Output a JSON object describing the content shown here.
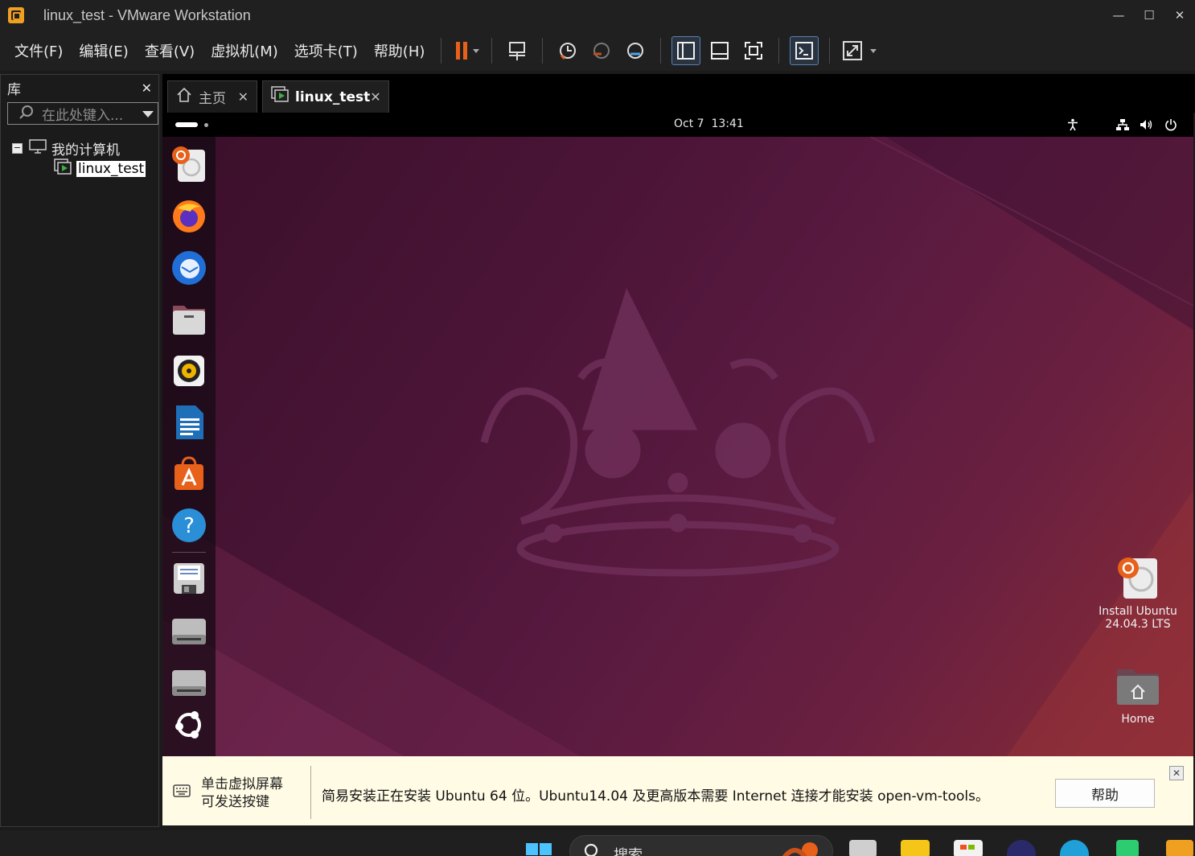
{
  "window": {
    "title": "linux_test - VMware Workstation"
  },
  "menu": {
    "items": [
      "文件(F)",
      "编辑(E)",
      "查看(V)",
      "虚拟机(M)",
      "选项卡(T)",
      "帮助(H)"
    ]
  },
  "library": {
    "title": "库",
    "search_placeholder": "在此处键入...",
    "tree_root": "我的计算机",
    "tree_child": "linux_test"
  },
  "tabs": [
    {
      "label": "主页"
    },
    {
      "label": "linux_test"
    }
  ],
  "guest": {
    "date": "Oct 7",
    "time": "13:41",
    "desktop_icons": [
      {
        "label_line1": "Install Ubuntu",
        "label_line2": "24.04.3 LTS"
      },
      {
        "label_line1": "Home"
      }
    ]
  },
  "hint": {
    "left_line1": "单击虚拟屏幕",
    "left_line2": "可发送按键",
    "message": "简易安装正在安装 Ubuntu 64 位。Ubuntu14.04 及更高版本需要 Internet 连接才能安装 open-vm-tools。",
    "help_button": "帮助"
  },
  "taskbar": {
    "search_label": "搜索"
  },
  "colors": {
    "accent_orange": "#e8611a",
    "ubuntu_bg": "#4c1538",
    "hint_bg": "#fffbe4"
  }
}
